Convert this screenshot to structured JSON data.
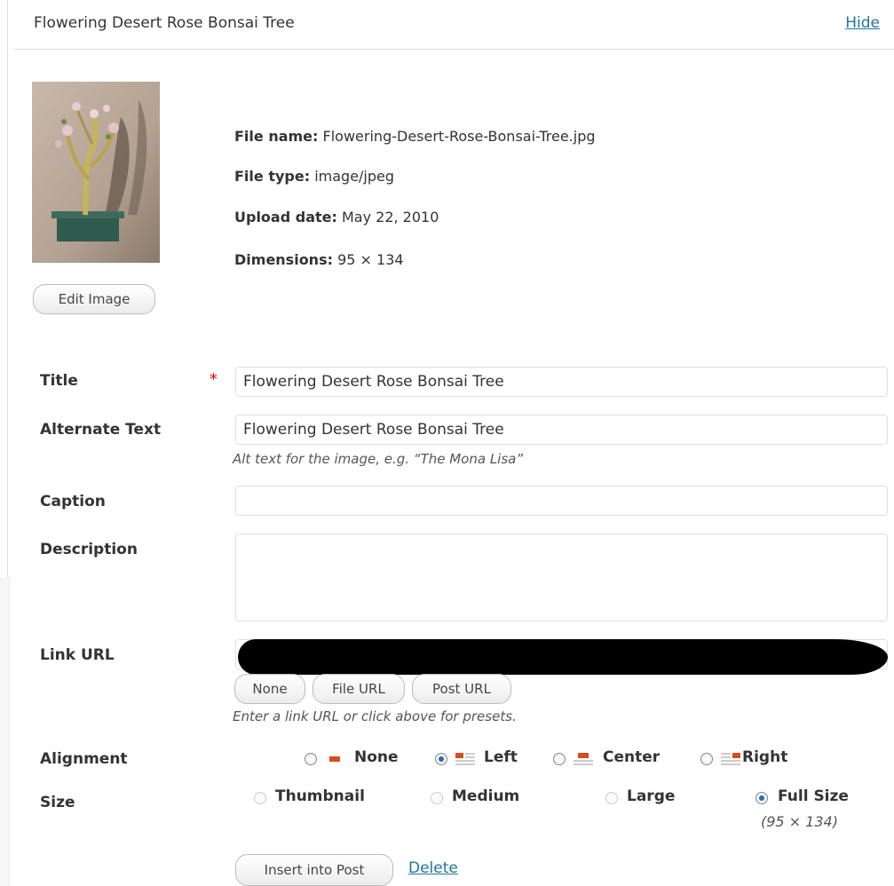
{
  "header": {
    "title": "Flowering Desert Rose Bonsai Tree",
    "hide": "Hide"
  },
  "image": {
    "edit_label": "Edit Image"
  },
  "meta": {
    "file_name_label": "File name:",
    "file_name": "Flowering-Desert-Rose-Bonsai-Tree.jpg",
    "file_type_label": "File type:",
    "file_type": "image/jpeg",
    "upload_date_label": "Upload date:",
    "upload_date": "May 22, 2010",
    "dimensions_label": "Dimensions:",
    "dimensions": "95 × 134"
  },
  "form": {
    "title_label": "Title",
    "required_mark": "*",
    "title_value": "Flowering Desert Rose Bonsai Tree",
    "alt_label": "Alternate Text",
    "alt_value": "Flowering Desert Rose Bonsai Tree",
    "alt_help": "Alt text for the image, e.g. “The Mona Lisa”",
    "caption_label": "Caption",
    "caption_value": "",
    "description_label": "Description",
    "description_value": "",
    "link_label": "Link URL",
    "link_buttons": [
      "None",
      "File URL",
      "Post URL"
    ],
    "link_help": "Enter a link URL or click above for presets.",
    "alignment_label": "Alignment",
    "alignment_options": [
      "None",
      "Left",
      "Center",
      "Right"
    ],
    "alignment_selected": "Left",
    "size_label": "Size",
    "size_options": [
      "Thumbnail",
      "Medium",
      "Large",
      "Full Size"
    ],
    "size_selected": "Full Size",
    "full_size_dims": "(95 × 134)",
    "insert_label": "Insert into Post",
    "delete_label": "Delete"
  },
  "colors": {
    "link": "#21759b",
    "required": "#ff0000",
    "accent": "#d54e21"
  }
}
